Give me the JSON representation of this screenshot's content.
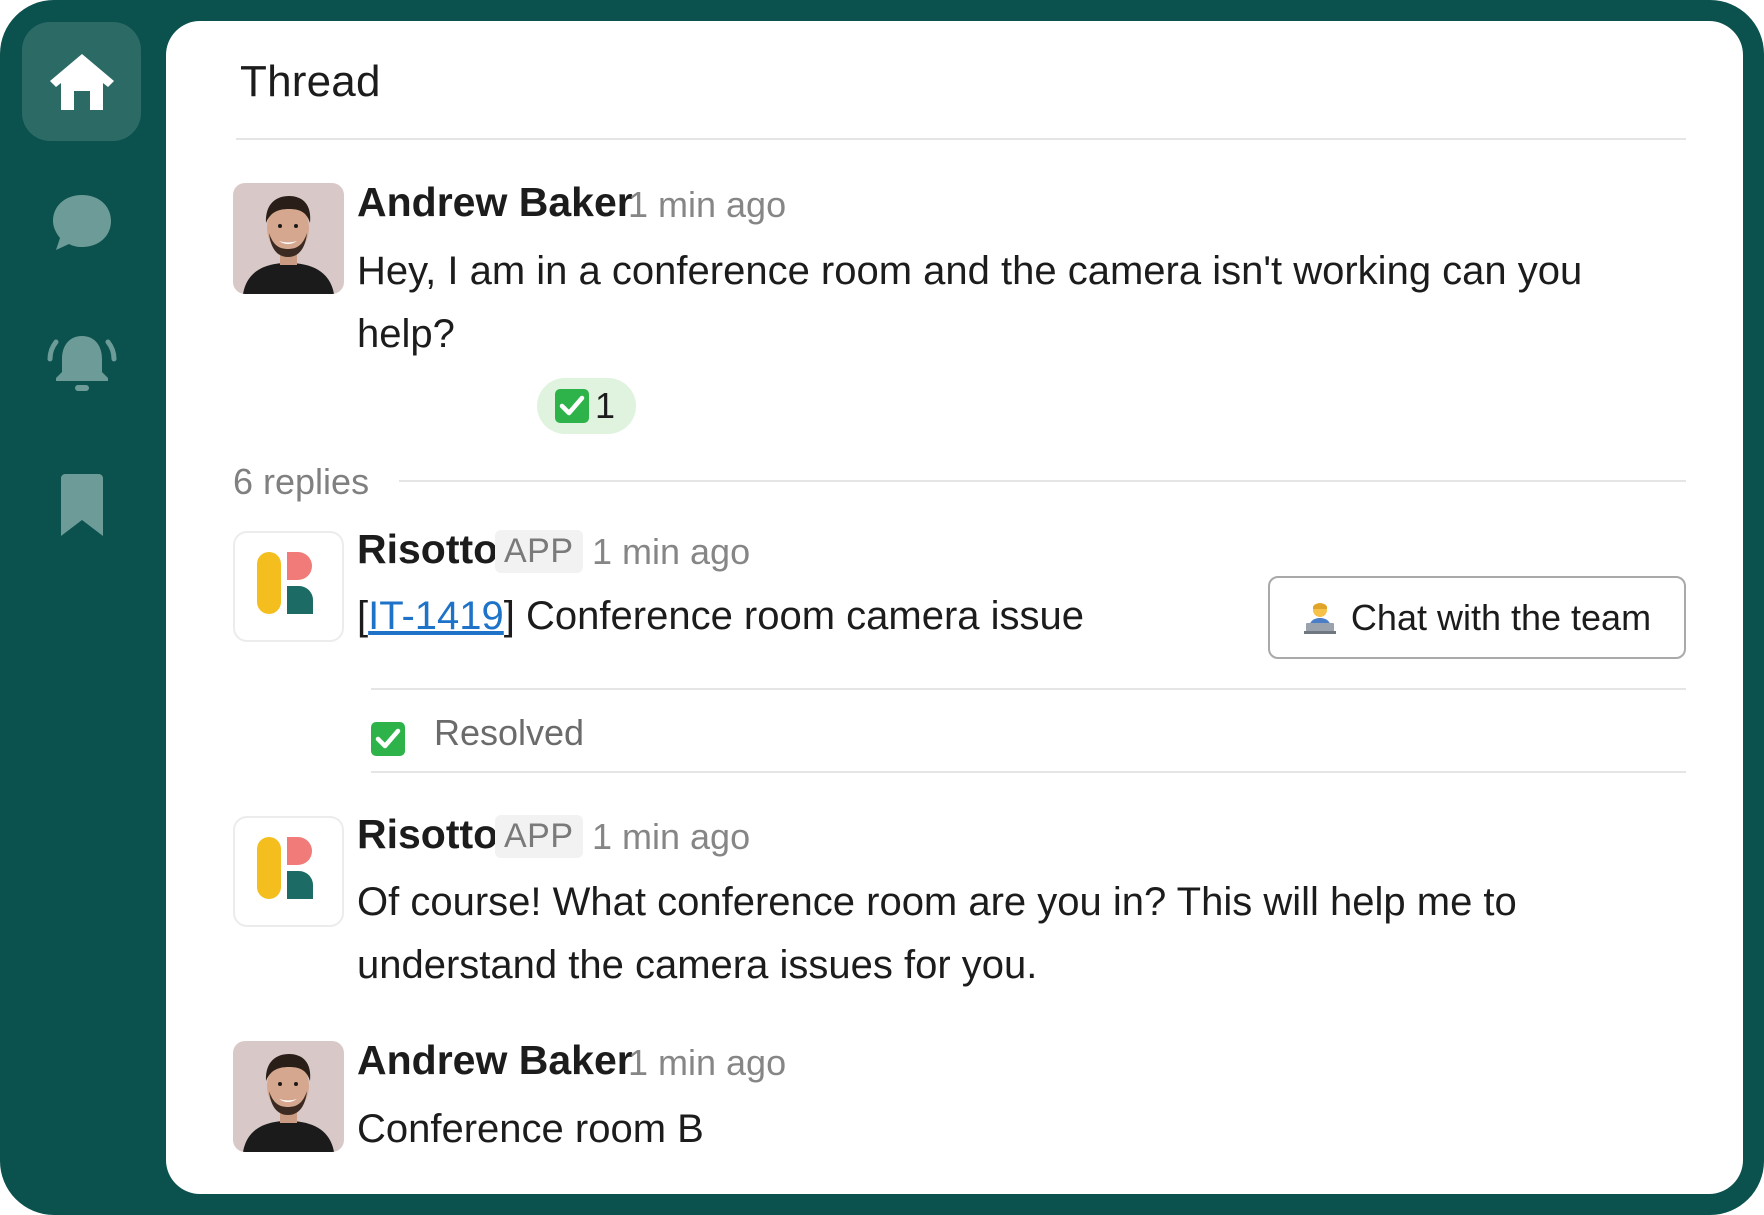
{
  "sidebar": {
    "items": [
      {
        "icon": "home-icon",
        "active": true
      },
      {
        "icon": "chat-bubble-icon",
        "active": false
      },
      {
        "icon": "bell-icon",
        "active": false
      },
      {
        "icon": "bookmark-icon",
        "active": false
      }
    ]
  },
  "thread": {
    "title": "Thread",
    "root": {
      "author": "Andrew Baker",
      "time": "1 min ago",
      "text": "Hey, I am in a conference room and the camera isn't working can you help?",
      "reaction": {
        "emoji": "white-check-mark",
        "count": "1"
      }
    },
    "replies_label": "6 replies",
    "replies": [
      {
        "author": "Risotto",
        "badge": "APP",
        "time": "1 min ago",
        "ticket_open": "[",
        "ticket_id": "IT-1419",
        "ticket_close": "]",
        "ticket_title": " Conference room camera issue",
        "button_label": "Chat with the team",
        "status": "Resolved"
      },
      {
        "author": "Risotto",
        "badge": "APP",
        "time": "1 min ago",
        "text": "Of course! What conference room are you in? This will help me to understand the camera issues for you."
      },
      {
        "author": "Andrew Baker",
        "time": "1 min ago",
        "text": "Conference room B"
      }
    ]
  },
  "colors": {
    "frame": "#0b514d",
    "active_nav": "#2c6a66",
    "icon_muted": "#6d9c98",
    "link": "#1e73c9",
    "check": "#2db34a"
  }
}
